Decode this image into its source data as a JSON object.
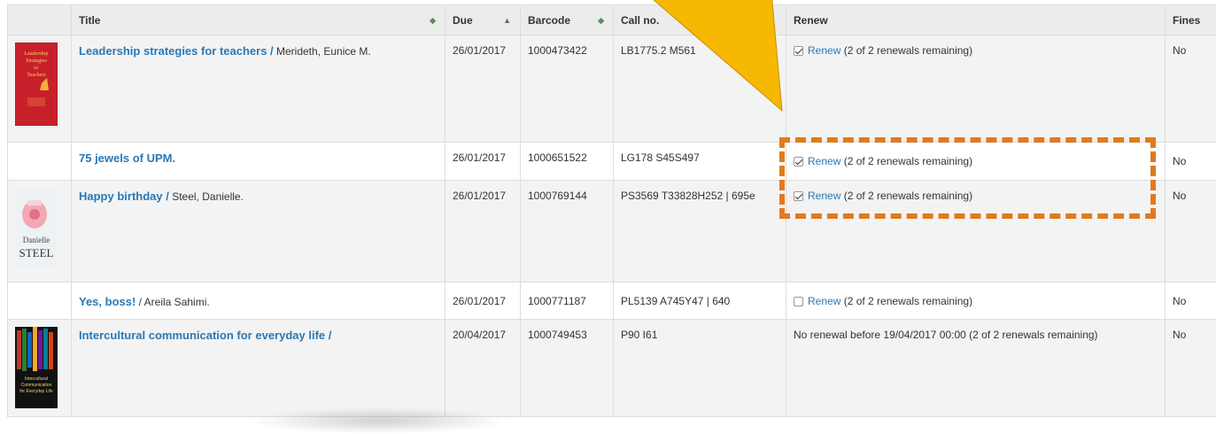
{
  "columns": {
    "title": "Title",
    "due": "Due",
    "barcode": "Barcode",
    "callno": "Call no.",
    "renew": "Renew",
    "fines": "Fines"
  },
  "renew_link": "Renew",
  "rows": [
    {
      "title": "Leadership strategies for teachers /",
      "author": "Merideth, Eunice M.",
      "due": "26/01/2017",
      "barcode": "1000473422",
      "callno": "LB1775.2 M561",
      "renew_note": "(2 of 2 renewals remaining)",
      "checked": true,
      "fines": "No",
      "cover_text": [
        "Leadership",
        "Strategies",
        "for",
        "Teachers"
      ]
    },
    {
      "title": "75 jewels of UPM.",
      "author": "",
      "due": "26/01/2017",
      "barcode": "1000651522",
      "callno": "LG178 S45S497",
      "renew_note": "(2 of 2 renewals remaining)",
      "checked": true,
      "fines": "No"
    },
    {
      "title": "Happy birthday /",
      "author": "Steel, Danielle.",
      "due": "26/01/2017",
      "barcode": "1000769144",
      "callno": "PS3569 T33828H252 | 695e",
      "renew_note": "(2 of 2 renewals remaining)",
      "checked": true,
      "fines": "No",
      "cover_text": [
        "Danielle",
        "STEEL"
      ]
    },
    {
      "title": "Yes, boss!",
      "author": "Areila Sahimi.",
      "due": "26/01/2017",
      "barcode": "1000771187",
      "callno": "PL5139 A745Y47 | 640",
      "renew_note": "(2 of 2 renewals remaining)",
      "checked": false,
      "fines": "No"
    },
    {
      "title": "Intercultural communication for everyday life /",
      "author": "",
      "due": "20/04/2017",
      "barcode": "1000749453",
      "callno": "P90 I61",
      "renew_text": "No renewal before 19/04/2017 00:00 (2 of 2 renewals remaining)",
      "fines": "No",
      "cover_text": [
        "Intercultural",
        "Communication",
        "for Everyday Life"
      ]
    }
  ],
  "colors": {
    "link": "#2a78b5",
    "header_bg": "#ececec",
    "callout": "#f6b800",
    "dash": "#e07a1f"
  }
}
